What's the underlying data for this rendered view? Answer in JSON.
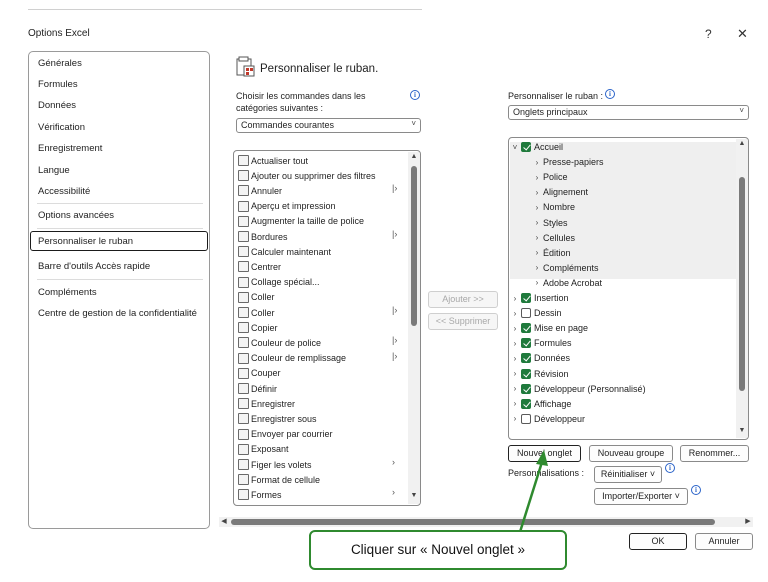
{
  "dialog": {
    "title": "Options Excel",
    "help_label": "?",
    "close_label": "✕"
  },
  "nav": {
    "items": [
      {
        "label": "Générales"
      },
      {
        "label": "Formules"
      },
      {
        "label": "Données"
      },
      {
        "label": "Vérification"
      },
      {
        "label": "Enregistrement"
      },
      {
        "label": "Langue"
      },
      {
        "label": "Accessibilité"
      },
      {
        "label": "Options avancées"
      },
      {
        "label": "Personnaliser le ruban"
      },
      {
        "label": "Barre d'outils Accès rapide"
      },
      {
        "label": "Compléments"
      },
      {
        "label": "Centre de gestion de la confidentialité"
      }
    ],
    "selected": "Personnaliser le ruban"
  },
  "header": {
    "title": "Personnaliser le ruban."
  },
  "left": {
    "choose_label": "Choisir les commandes dans les catégories suivantes :",
    "choose_label_line1": "Choisir les commandes dans les",
    "choose_label_line2": "catégories suivantes :",
    "combo_value": "Commandes courantes",
    "commands": [
      {
        "label": "Actualiser tout",
        "submenu": false
      },
      {
        "label": "Ajouter ou supprimer des filtres",
        "submenu": false
      },
      {
        "label": "Annuler",
        "submenu": true
      },
      {
        "label": "Aperçu et impression",
        "submenu": false
      },
      {
        "label": "Augmenter la taille de police",
        "submenu": false
      },
      {
        "label": "Bordures",
        "submenu": true
      },
      {
        "label": "Calculer maintenant",
        "submenu": false
      },
      {
        "label": "Centrer",
        "submenu": false
      },
      {
        "label": "Collage spécial...",
        "submenu": false
      },
      {
        "label": "Coller",
        "submenu": false
      },
      {
        "label": "Coller",
        "submenu": true
      },
      {
        "label": "Copier",
        "submenu": false
      },
      {
        "label": "Couleur de police",
        "submenu": true
      },
      {
        "label": "Couleur de remplissage",
        "submenu": true
      },
      {
        "label": "Couper",
        "submenu": false
      },
      {
        "label": "Définir",
        "submenu": false
      },
      {
        "label": "Enregistrer",
        "submenu": false
      },
      {
        "label": "Enregistrer sous",
        "submenu": false
      },
      {
        "label": "Envoyer par courrier",
        "submenu": false
      },
      {
        "label": "Exposant",
        "submenu": false
      },
      {
        "label": "Figer les volets",
        "submenu": true
      },
      {
        "label": "Format de cellule",
        "submenu": false
      },
      {
        "label": "Formes",
        "submenu": true
      }
    ]
  },
  "middle": {
    "add_label": "Ajouter >>",
    "remove_label": "<< Supprimer"
  },
  "right": {
    "customize_label": "Personnaliser le ruban :",
    "combo_value": "Onglets principaux",
    "tree": [
      {
        "label": "Accueil",
        "level": 0,
        "checked": true,
        "expanded": true
      },
      {
        "label": "Presse-papiers",
        "level": 1
      },
      {
        "label": "Police",
        "level": 1
      },
      {
        "label": "Alignement",
        "level": 1
      },
      {
        "label": "Nombre",
        "level": 1
      },
      {
        "label": "Styles",
        "level": 1
      },
      {
        "label": "Cellules",
        "level": 1
      },
      {
        "label": "Édition",
        "level": 1
      },
      {
        "label": "Compléments",
        "level": 1
      },
      {
        "label": "Adobe Acrobat",
        "level": 1
      },
      {
        "label": "Insertion",
        "level": 0,
        "checked": true
      },
      {
        "label": "Dessin",
        "level": 0,
        "checked": false
      },
      {
        "label": "Mise en page",
        "level": 0,
        "checked": true
      },
      {
        "label": "Formules",
        "level": 0,
        "checked": true
      },
      {
        "label": "Données",
        "level": 0,
        "checked": true
      },
      {
        "label": "Révision",
        "level": 0,
        "checked": true
      },
      {
        "label": "Développeur (Personnalisé)",
        "level": 0,
        "checked": true
      },
      {
        "label": "Affichage",
        "level": 0,
        "checked": true
      },
      {
        "label": "Développeur",
        "level": 0,
        "checked": false
      }
    ],
    "new_tab_label": "Nouvel onglet",
    "new_group_label": "Nouveau groupe",
    "rename_label": "Renommer...",
    "customizations_label": "Personnalisations :",
    "reset_label": "Réinitialiser ˅",
    "import_export_label": "Importer/Exporter ˅"
  },
  "footer": {
    "ok_label": "OK",
    "cancel_label": "Annuler"
  },
  "callout": {
    "text": "Cliquer sur « Nouvel onglet »"
  },
  "colors": {
    "callout_green": "#2f8a2f",
    "checkbox_green": "#1f7a3c",
    "info_blue": "#2a63c9"
  }
}
